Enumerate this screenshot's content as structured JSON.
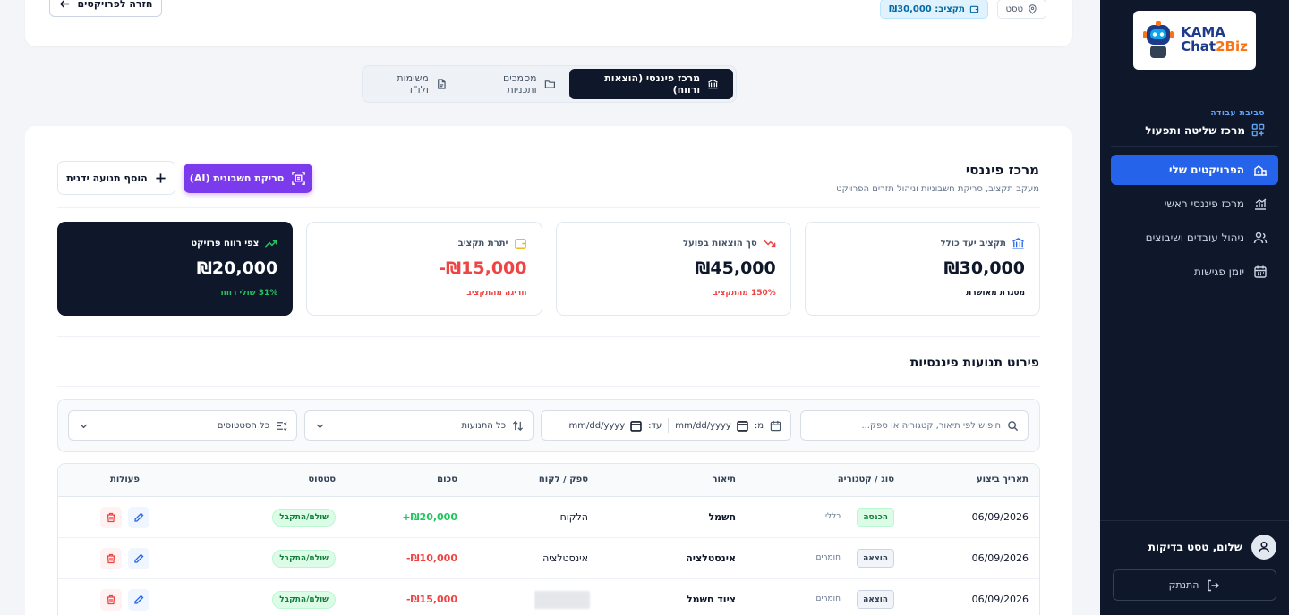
{
  "sidebar": {
    "logo": {
      "line1": "KAMA",
      "line2a": "Chat",
      "line2b": "2Biz"
    },
    "workspace_label": "סביבת עבודה",
    "workspace_title": "מרכז שליטה ותפעול",
    "items": [
      {
        "label": "הפרויקטים שלי",
        "icon": "projects-icon",
        "active": true
      },
      {
        "label": "מרכז פיננסי ראשי",
        "icon": "chart-icon",
        "active": false
      },
      {
        "label": "ניהול עובדים ושיבוצים",
        "icon": "users-icon",
        "active": false
      },
      {
        "label": "יומן פגישות",
        "icon": "calendar-icon",
        "active": false
      }
    ],
    "user_greeting": "שלום, טסט בדיקות",
    "logout_label": "התנתק"
  },
  "header": {
    "back_label": "חזרה לפרויקטים",
    "location_chip": "טסט",
    "budget_chip": "תקציב: ₪30,000"
  },
  "tabs": [
    {
      "label": "מרכז פיננסי (הוצאות ורווח)",
      "active": true
    },
    {
      "label": "מסמכים ותכניות",
      "active": false
    },
    {
      "label": "משימות ולו\"ז",
      "active": false
    }
  ],
  "finance": {
    "title": "מרכז פיננסי",
    "subtitle": "מעקב תקציב, סריקת חשבוניות וניהול תזרים הפרויקט",
    "scan_button": "סריקת חשבונית (AI)",
    "add_button": "הוסף תנועה ידנית",
    "cards": [
      {
        "label": "תקציב יעד כולל",
        "value": "₪30,000",
        "note": "מסגרת מאושרת",
        "tone": "neutral"
      },
      {
        "label": "סך הוצאות בפועל",
        "value": "₪45,000",
        "note": "150% מהתקציב",
        "tone": "red"
      },
      {
        "label": "יתרת תקציב",
        "value": "-₪15,000",
        "note": "חריגה מהתקציב",
        "tone": "red"
      },
      {
        "label": "צפי רווח פרויקט",
        "value": "₪20,000",
        "note": "31% שולי רווח",
        "tone": "dark"
      }
    ],
    "section_title": "פירוט תנועות פיננסיות",
    "filters": {
      "search_placeholder": "חיפוש לפי תיאור, קטגוריה או ספק...",
      "from_label": "מ:",
      "to_label": "עד:",
      "date_placeholder": "mm/dd/yyyy",
      "type_value": "כל התנועות",
      "status_value": "כל הסטטוסים"
    },
    "table": {
      "headers": [
        "תאריך ביצוע",
        "סוג / קטגוריה",
        "תיאור",
        "ספק / לקוח",
        "סכום",
        "סטטוס",
        "פעולות"
      ],
      "rows": [
        {
          "date": "06/09/2026",
          "type": "הכנסה",
          "type_kind": "in",
          "category": "כללי",
          "desc": "חשמל",
          "party": "הלקוח",
          "amount": "+₪20,000",
          "amount_kind": "pos",
          "status": "שולם/התקבל"
        },
        {
          "date": "06/09/2026",
          "type": "הוצאה",
          "type_kind": "out",
          "category": "חומרים",
          "desc": "אינסטלציה",
          "party": "אינסטלציה",
          "amount": "-₪10,000",
          "amount_kind": "neg",
          "status": "שולם/התקבל"
        },
        {
          "date": "06/09/2026",
          "type": "הוצאה",
          "type_kind": "out",
          "category": "חומרים",
          "desc": "ציוד חשמל",
          "party": "",
          "amount": "-₪15,000",
          "amount_kind": "neg",
          "status": "שולם/התקבל"
        }
      ]
    }
  },
  "colors": {
    "sidebar_bg": "#0f172a",
    "accent_blue": "#2563eb",
    "ai_purple": "#7c3aed",
    "negative": "#ef4444",
    "positive": "#22c55e"
  }
}
